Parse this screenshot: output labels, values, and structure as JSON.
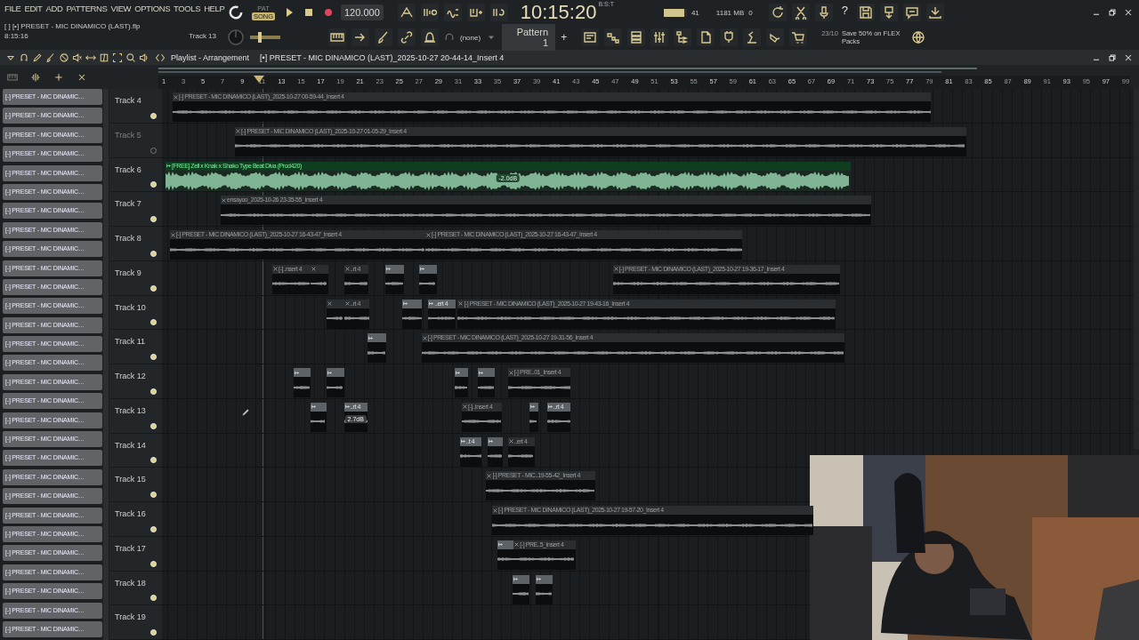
{
  "menu": [
    "FILE",
    "EDIT",
    "ADD",
    "PATTERNS",
    "VIEW",
    "OPTIONS",
    "TOOLS",
    "HELP"
  ],
  "project": {
    "file": "[  ] [•] PRESET - MIC DINAMICO (LAST).flp",
    "time": "8:15:16",
    "hint": "Track 13"
  },
  "transport": {
    "pat_label": "PAT",
    "song_label": "SONG",
    "song_mode": true,
    "tempo": "120.000",
    "clock": "10:15:20",
    "clock_unit": "B:S:T",
    "master_slider": {
      "level": 0.3
    }
  },
  "monitor": {
    "cpu": "41",
    "level": 0.9,
    "memory": "1181 MB",
    "polyphony": "0",
    "help": "?"
  },
  "pattern": {
    "channel": "(none)",
    "name": "Pattern 1",
    "add": "+"
  },
  "news": {
    "date": "23/10",
    "text": "Save 50% on FLEX Packs"
  },
  "playlist": {
    "title": "Playlist - Arrangement",
    "clip_source": "[•] PRESET - MIC DINAMICO (LAST)_2025-10-27 20-44-14_Insert 4",
    "ruler": [
      "1",
      "3",
      "5",
      "7",
      "9",
      "11",
      "13",
      "15",
      "17",
      "19",
      "21",
      "23",
      "25",
      "27",
      "29",
      "31",
      "33",
      "35",
      "37",
      "39",
      "41",
      "43",
      "45",
      "47",
      "49",
      "51",
      "53",
      "55",
      "57",
      "59",
      "61",
      "63",
      "65",
      "67",
      "69",
      "71",
      "73",
      "75",
      "77",
      "79",
      "81",
      "83",
      "85",
      "87",
      "89",
      "91",
      "93",
      "95",
      "97",
      "99"
    ]
  },
  "browser": [
    "[-] PRESET - MIC DINAMIC…",
    "[-] PRESET - MIC DINAMIC…",
    "[-] PRESET - MIC DINAMIC…",
    "[-] PRESET - MIC DINAMIC…",
    "[-] PRESET - MIC DINAMIC…",
    "[-] PRESET - MIC DINAMIC…",
    "[-] PRESET - MIC DINAMIC…",
    "[-] PRESET - MIC DINAMIC…",
    "[-] PRESET - MIC DINAMIC…",
    "[-] PRESET - MIC DINAMIC…",
    "[-] PRESET - MIC DINAMIC…",
    "[-] PRESET - MIC DINAMIC…",
    "[-] PRESET - MIC DINAMIC…",
    "[-] PRESET - MIC DINAMIC…",
    "[-] PRESET - MIC DINAMIC…",
    "[-] PRESET - MIC DINAMIC…",
    "[-] PRESET - MIC DINAMIC…",
    "[-] PRESET - MIC DINAMIC…",
    "[-] PRESET - MIC DINAMIC…",
    "[-] PRESET - MIC DINAMIC…",
    "[-] PRESET - MIC DINAMIC…",
    "[-] PRESET - MIC DINAMIC…",
    "[-] PRESET - MIC DINAMIC…",
    "[-] PRESET - MIC DINAMIC…",
    "[-] PRESET - MIC DINAMIC…",
    "[-] PRESET - MIC DINAMIC…",
    "[-] PRESET - MIC DINAMIC…",
    "[-] PRESET - MIC DINAMIC…",
    "[-] PRESET - MIC DINAMIC…"
  ],
  "tracks": [
    {
      "name": "Track 4",
      "enabled": true,
      "clips": [
        {
          "kind": "audio",
          "label": "[-] PRESET - MIC DINAMICO (LAST)_2025-10-27 00-59-44_Insert 4"
        }
      ]
    },
    {
      "name": "Track 5",
      "enabled": false,
      "clips": [
        {
          "kind": "audio",
          "label": "[-] PRESET - MIC DINAMICO (LAST)_2025-10-27 01-05-29_Insert 4"
        }
      ]
    },
    {
      "name": "Track 6",
      "enabled": true,
      "clips": [
        {
          "kind": "beat",
          "label": "[FREE] Zell x Knak x Shako  Type Beat  Diva  (Prod420)",
          "gain": "-2.0dB"
        }
      ]
    },
    {
      "name": "Track 7",
      "enabled": true,
      "clips": [
        {
          "kind": "audio",
          "label": "ensayoo_2025-10-26 23-35-55_Insert 4"
        }
      ]
    },
    {
      "name": "Track 8",
      "enabled": true,
      "clips": [
        {
          "kind": "audio",
          "label": "[-] PRESET - MIC DINAMICO (LAST)_2025-10-27 16-43-47_Insert 4"
        },
        {
          "kind": "audio",
          "label": "[-] PRESET - MIC DINAMICO (LAST)_2025-10-27 16-43-47_Insert 4"
        }
      ]
    },
    {
      "name": "Track 9",
      "enabled": true,
      "clips": [
        {
          "kind": "audio",
          "label": "[-]..nsert 4"
        },
        {
          "kind": "audio"
        },
        {
          "kind": "audio",
          "label": "..rt 4"
        },
        {
          "kind": "chop"
        },
        {
          "kind": "chop"
        },
        {
          "kind": "audio",
          "label": "[-] PRESET - MIC DINAMICO (LAST)_2025-10-27 19-36-17_Insert 4"
        }
      ]
    },
    {
      "name": "Track 10",
      "enabled": true,
      "clips": [
        {
          "kind": "audio"
        },
        {
          "kind": "audio",
          "label": "..rt 4"
        },
        {
          "kind": "chop"
        },
        {
          "kind": "chop",
          "label": "..ert 4"
        },
        {
          "kind": "audio",
          "label": "[-] PRESET - MIC DINAMICO (LAST)_2025-10-27 19-43-16_Insert 4"
        }
      ]
    },
    {
      "name": "Track 11",
      "enabled": true,
      "clips": [
        {
          "kind": "chop"
        },
        {
          "kind": "audio",
          "label": "[-] PRESET - MIC DINAMICO (LAST)_2025-10-27 19-31-56_Insert 4"
        }
      ]
    },
    {
      "name": "Track 12",
      "enabled": true,
      "clips": [
        {
          "kind": "chop"
        },
        {
          "kind": "chop"
        },
        {
          "kind": "chop"
        },
        {
          "kind": "chop"
        },
        {
          "kind": "audio",
          "label": "[-] PRE..01_Insert 4"
        }
      ]
    },
    {
      "name": "Track 13",
      "enabled": true,
      "clips": [
        {
          "kind": "chop"
        },
        {
          "kind": "chop",
          "label": "..rt 4",
          "gain": "2.7dB"
        },
        {
          "kind": "audio",
          "label": "[-]..Insert 4"
        },
        {
          "kind": "chop"
        },
        {
          "kind": "chop",
          "label": "..rt 4"
        }
      ]
    },
    {
      "name": "Track 14",
      "enabled": true,
      "clips": [
        {
          "kind": "chop",
          "label": "..t 4"
        },
        {
          "kind": "chop"
        },
        {
          "kind": "audio",
          "label": "..ert 4"
        }
      ]
    },
    {
      "name": "Track 15",
      "enabled": true,
      "clips": [
        {
          "kind": "audio",
          "label": "[-] PRESET - MIC..19-55-42_Insert 4"
        }
      ]
    },
    {
      "name": "Track 16",
      "enabled": true,
      "clips": [
        {
          "kind": "audio",
          "label": "[-] PRESET - MIC DINAMICO (LAST)_2025-10-27 19-57-20_Insert 4"
        }
      ]
    },
    {
      "name": "Track 17",
      "enabled": true,
      "clips": [
        {
          "kind": "chop"
        },
        {
          "kind": "audio",
          "label": "[-] PRE..5_Insert 4"
        }
      ]
    },
    {
      "name": "Track 18",
      "enabled": true,
      "clips": [
        {
          "kind": "chop"
        },
        {
          "kind": "chop"
        }
      ]
    },
    {
      "name": "Track 19",
      "enabled": true
    }
  ]
}
